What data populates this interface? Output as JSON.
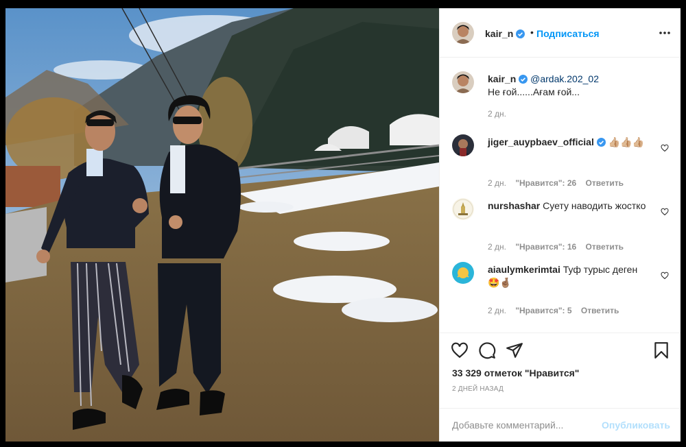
{
  "post_header": {
    "username": "kair_n",
    "dot": "•",
    "follow_label": "Подписаться"
  },
  "caption": {
    "username": "kair_n",
    "mention": "@ardak.202_02",
    "text": "Не ғой......Ағам ғой...",
    "age": "2 дн."
  },
  "comments": [
    {
      "username": "jiger_auypbaev_official",
      "verified": true,
      "text": "👍🏼👍🏼👍🏼",
      "age": "2 дн.",
      "likes": "\"Нравится\": 26",
      "reply": "Ответить"
    },
    {
      "username": "nurshashar",
      "verified": false,
      "text": "Суету наводить жостко",
      "age": "2 дн.",
      "likes": "\"Нравится\": 16",
      "reply": "Ответить"
    },
    {
      "username": "aiaulymkerimtai",
      "verified": false,
      "text": "Туф турыс деген🤩🤞🏽",
      "age": "2 дн.",
      "likes": "\"Нравится\": 5",
      "reply": "Ответить"
    }
  ],
  "actions": {
    "likes_count": "33 329 отметок \"Нравится\"",
    "time_ago": "2 дней назад"
  },
  "add_comment": {
    "placeholder": "Добавьте комментарий...",
    "publish_label": "Опубликовать"
  },
  "colors": {
    "accent_blue": "#0095f6",
    "publish_disabled": "#b2dffc",
    "verified_blue": "#3897f0",
    "muted_text": "#8e8e8e"
  }
}
